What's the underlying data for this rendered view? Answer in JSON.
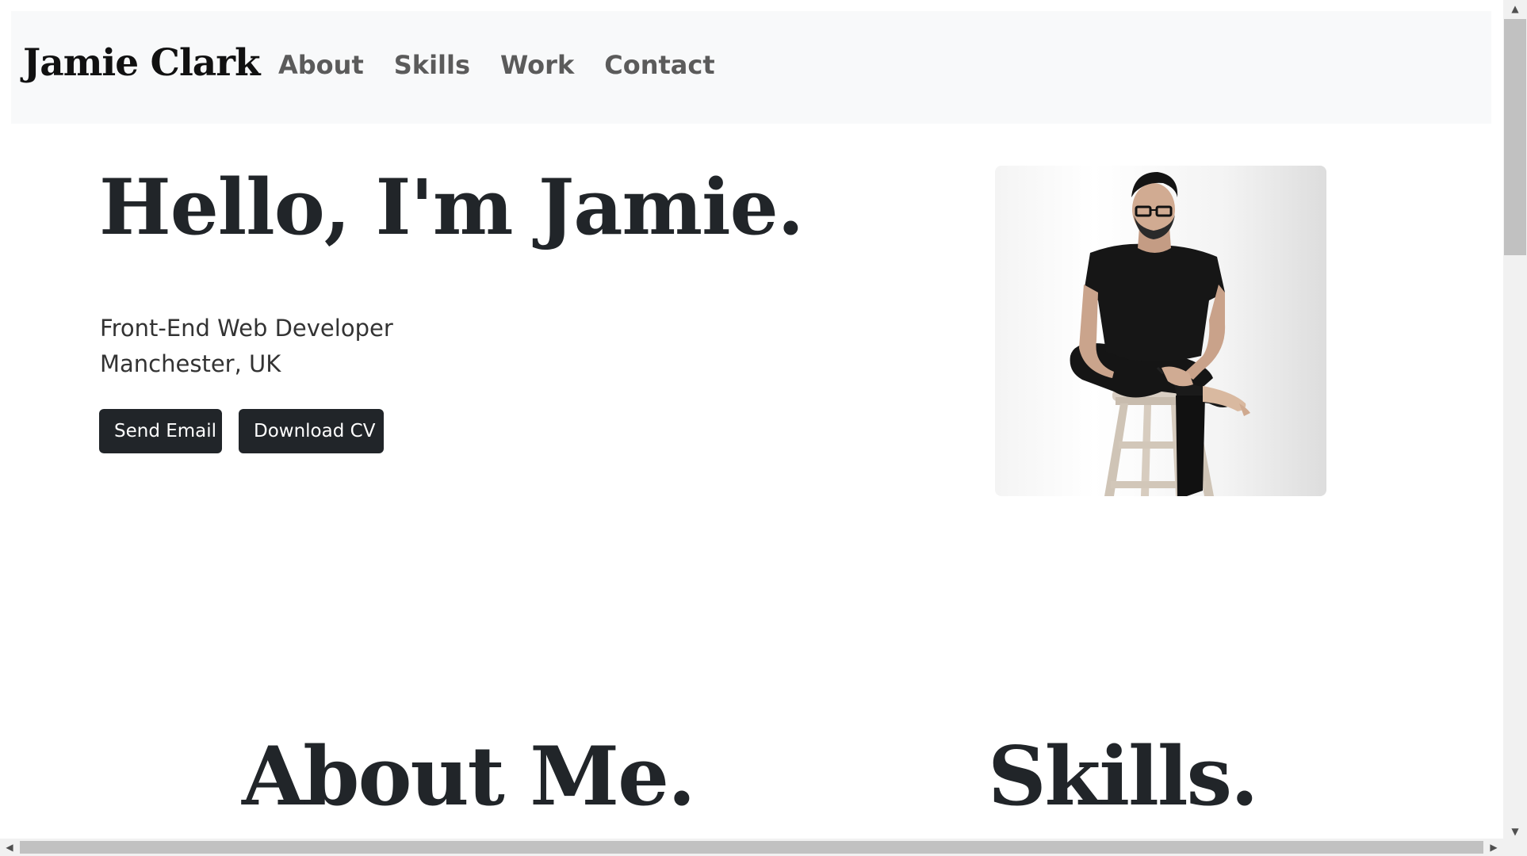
{
  "navbar": {
    "brand": "Jamie Clark",
    "links": [
      "About",
      "Skills",
      "Work",
      "Contact"
    ]
  },
  "hero": {
    "title": "Hello, I'm Jamie.",
    "role": "Front-End Web Developer",
    "location": "Manchester, UK",
    "buttons": {
      "email": "Send Email",
      "cv": "Download CV"
    },
    "portrait_icon": "portrait-photo"
  },
  "sections": {
    "about_heading": "About Me.",
    "skills_heading": "Skills."
  },
  "scrollbars": {
    "up_arrow": "▲",
    "down_arrow": "▼",
    "left_arrow": "◀",
    "right_arrow": "▶"
  },
  "colors": {
    "navbar_bg": "#f8f9fa",
    "button_bg": "#212529",
    "text_dark": "#212529",
    "nav_link": "#5b5b5b"
  }
}
